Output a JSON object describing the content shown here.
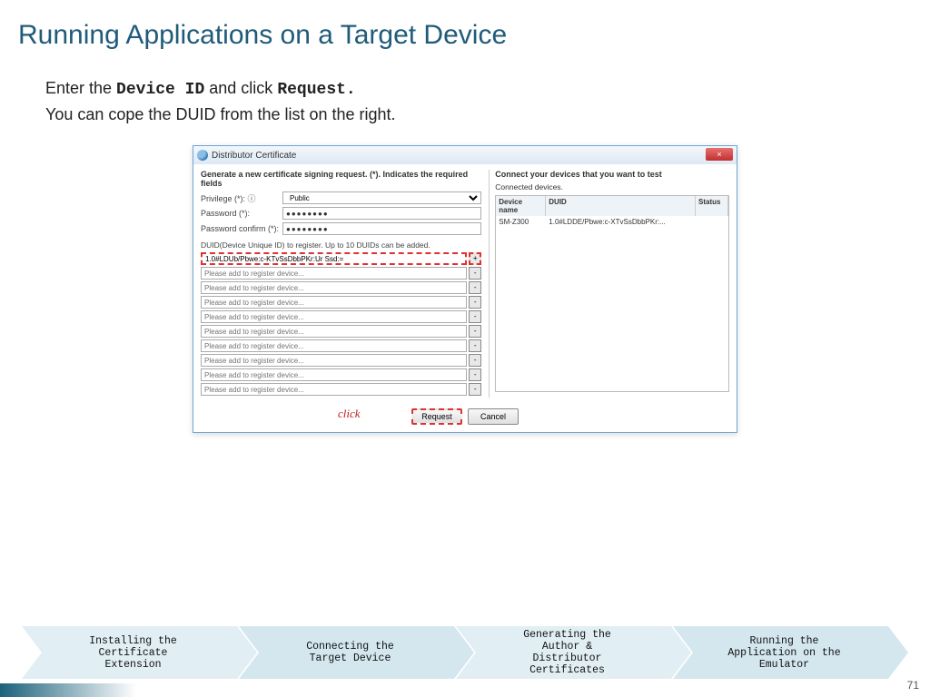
{
  "title": "Running Applications on a Target Device",
  "instructions": {
    "line1_a": "Enter the ",
    "line1_mono1": "Device ID",
    "line1_b": " and click ",
    "line1_mono2": "Request.",
    "line2": "You can cope the DUID from the list on the right."
  },
  "dialog": {
    "window_title": "Distributor Certificate",
    "close": "×",
    "left_subtitle": "Generate a new certificate signing request. (*). Indicates the required fields",
    "privilege_label": "Privilege (*): ⓘ",
    "privilege_value": "Public",
    "password_label": "Password (*):",
    "password_confirm_label": "Password confirm (*):",
    "password_dots": "●●●●●●●●",
    "duid_note": "DUID(Device Unique ID) to register. Up to 10 DUIDs can be added.",
    "duid_first_value": "1.0#LDUb/Pbwe:c-KTvSsDbbPKr:Ur Ssd:=",
    "duid_placeholder": "Please add to register device...",
    "right_subtitle": "Connect your devices that you want to test",
    "right_subtitle2": "Connected devices.",
    "th_name": "Device name",
    "th_duid": "DUID",
    "th_status": "Status",
    "device_row": {
      "name": "SM-Z300",
      "duid": "1.0#LDDE/Pbwe:c-XTvSsDbbPKr:..."
    },
    "btn_request": "Request",
    "btn_cancel": "Cancel",
    "click_label": "click"
  },
  "chevrons": [
    "Installing the\nCertificate\nExtension",
    "Connecting the\nTarget Device",
    "Generating the\nAuthor &\nDistributor\nCertificates",
    "Running the\nApplication on the\nEmulator"
  ],
  "page_number": "71"
}
